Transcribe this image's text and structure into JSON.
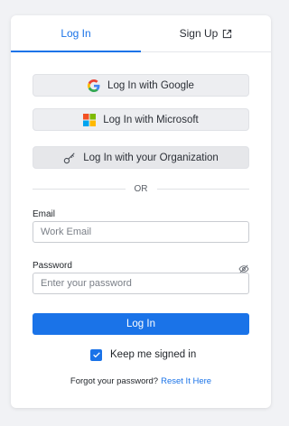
{
  "tabs": {
    "login_label": "Log In",
    "signup_label": "Sign Up"
  },
  "sso": {
    "google_label": "Log In with Google",
    "microsoft_label": "Log In with Microsoft",
    "org_label": "Log In with your Organization"
  },
  "divider_text": "OR",
  "email": {
    "label": "Email",
    "placeholder": "Work Email",
    "value": ""
  },
  "password": {
    "label": "Password",
    "placeholder": "Enter your password",
    "value": ""
  },
  "submit_label": "Log In",
  "keep_signed_in": {
    "label": "Keep me signed in",
    "checked": true
  },
  "forgot": {
    "text": "Forgot your password?",
    "link_label": "Reset It Here"
  },
  "colors": {
    "accent": "#1a73e8",
    "background": "#f1f2f5",
    "card": "#ffffff"
  },
  "icons": {
    "google": "google-logo-icon",
    "microsoft": "microsoft-logo-icon",
    "organization": "key-icon",
    "external": "external-link-icon",
    "password_toggle": "eye-slash-icon",
    "checkbox": "checkmark-icon"
  }
}
